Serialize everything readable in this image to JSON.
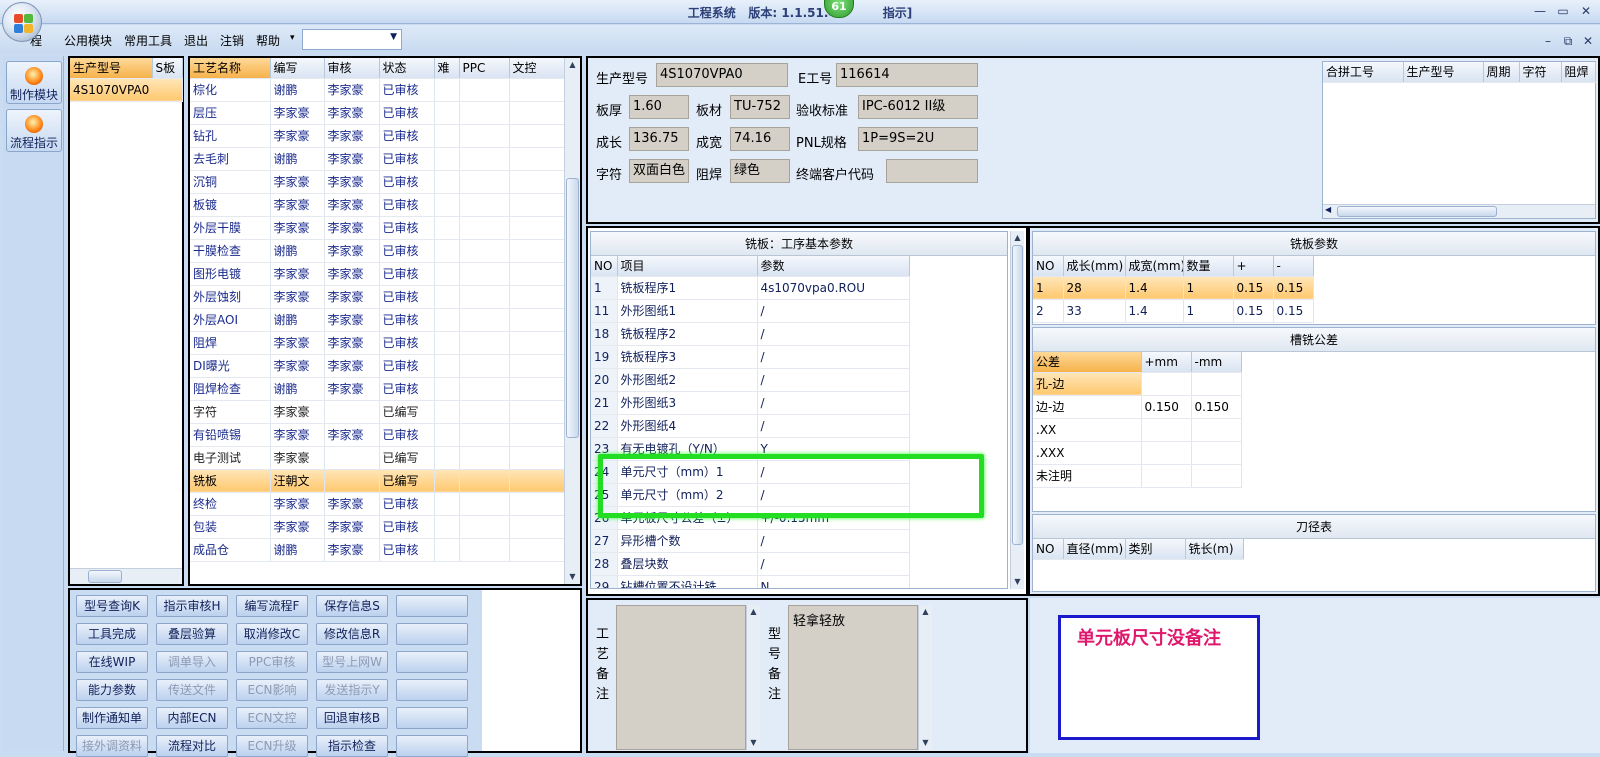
{
  "window": {
    "title_prefix": "工程系统",
    "version_label": "版本:",
    "version": "1.1.51.4",
    "title_suffix": "指示]",
    "badge": "61",
    "minimize": "—",
    "maximize": "▭",
    "close": "✕",
    "mdi_minimize": "–",
    "mdi_restore": "⧉",
    "mdi_close": "✕"
  },
  "menu": {
    "items": [
      "程",
      "公用模块",
      "常用工具",
      "退出",
      "注销",
      "帮助",
      "▾"
    ],
    "combo_value": ""
  },
  "left_toolbar": {
    "buttons": [
      "制作模块",
      "流程指示"
    ]
  },
  "model_list": {
    "headers": [
      "生产型号",
      "S板"
    ],
    "rows": [
      "4S1070VPA0"
    ]
  },
  "process_table": {
    "headers": [
      "工艺名称",
      "编写",
      "审核",
      "状态",
      "难",
      "PPC",
      "文控"
    ],
    "rows": [
      [
        "棕化",
        "谢鹏",
        "李家豪",
        "已审核"
      ],
      [
        "层压",
        "李家豪",
        "李家豪",
        "已审核"
      ],
      [
        "钻孔",
        "李家豪",
        "李家豪",
        "已审核"
      ],
      [
        "去毛刺",
        "谢鹏",
        "李家豪",
        "已审核"
      ],
      [
        "沉铜",
        "李家豪",
        "李家豪",
        "已审核"
      ],
      [
        "板镀",
        "李家豪",
        "李家豪",
        "已审核"
      ],
      [
        "外层干膜",
        "李家豪",
        "李家豪",
        "已审核"
      ],
      [
        "干膜检查",
        "谢鹏",
        "李家豪",
        "已审核"
      ],
      [
        "图形电镀",
        "李家豪",
        "李家豪",
        "已审核"
      ],
      [
        "外层蚀刻",
        "李家豪",
        "李家豪",
        "已审核"
      ],
      [
        "外层AOI",
        "谢鹏",
        "李家豪",
        "已审核"
      ],
      [
        "阻焊",
        "李家豪",
        "李家豪",
        "已审核"
      ],
      [
        "DI曝光",
        "李家豪",
        "李家豪",
        "已审核"
      ],
      [
        "阻焊检查",
        "谢鹏",
        "李家豪",
        "已审核"
      ],
      [
        "字符",
        "李家豪",
        "",
        "已编写"
      ],
      [
        "有铅喷锡",
        "李家豪",
        "李家豪",
        "已审核"
      ],
      [
        "电子测试",
        "李家豪",
        "",
        "已编写"
      ],
      [
        "铣板",
        "汪朝文",
        "",
        "已编写"
      ],
      [
        "终检",
        "李家豪",
        "李家豪",
        "已审核"
      ],
      [
        "包装",
        "李家豪",
        "李家豪",
        "已审核"
      ],
      [
        "成品仓",
        "谢鹏",
        "李家豪",
        "已审核"
      ]
    ]
  },
  "buttons": [
    [
      "型号查询K",
      "指示审核H",
      "编写流程F",
      "保存信息S",
      ""
    ],
    [
      "工具完成",
      "叠层验算",
      "取消修改C",
      "修改信息R",
      ""
    ],
    [
      "在线WIP",
      "调单导入",
      "PPC审核",
      "型号上网W",
      ""
    ],
    [
      "能力参数",
      "传送文件",
      "ECN影响",
      "发送指示Y",
      ""
    ],
    [
      "制作通知单",
      "内部ECN",
      "ECN文控",
      "回退审核B",
      ""
    ],
    [
      "接外调资料",
      "流程对比",
      "ECN升级",
      "指示检查",
      ""
    ]
  ],
  "info": {
    "model_label": "生产型号",
    "model": "4S1070VPA0",
    "e_label": "E工号",
    "e_no": "116614",
    "thick_label": "板厚",
    "thick": "1.60",
    "mat_label": "板材",
    "mat": "TU-752",
    "std_label": "验收标准",
    "std": "IPC-6012 II级",
    "len_label": "成长",
    "len": "136.75",
    "wid_label": "成宽",
    "wid": "74.16",
    "pnl_label": "PNL规格",
    "pnl": "1P=9S=2U",
    "char_label": "字符",
    "char": "双面白色",
    "mask_label": "阻焊",
    "mask": "绿色",
    "cust_label": "终端客户代码",
    "cust": ""
  },
  "merge_table": {
    "headers": [
      "合拼工号",
      "生产型号",
      "周期",
      "字符",
      "阻焊"
    ]
  },
  "mill_basic": {
    "title": "铣板：工序基本参数",
    "headers": [
      "NO",
      "项目",
      "参数"
    ],
    "rows": [
      [
        "1",
        "铣板程序1",
        "4s1070vpa0.ROU"
      ],
      [
        "11",
        "外形图纸1",
        "/"
      ],
      [
        "18",
        "铣板程序2",
        "/"
      ],
      [
        "19",
        "铣板程序3",
        "/"
      ],
      [
        "20",
        "外形图纸2",
        "/"
      ],
      [
        "21",
        "外形图纸3",
        "/"
      ],
      [
        "22",
        "外形图纸4",
        "/"
      ],
      [
        "23",
        "有无电镀孔（Y/N）",
        "Y"
      ],
      [
        "24",
        "单元尺寸（mm）1",
        "/"
      ],
      [
        "25",
        "单元尺寸（mm）2",
        "/"
      ],
      [
        "26",
        "单元板尺寸公差（±）",
        "+/-0.15mm"
      ],
      [
        "27",
        "异形槽个数",
        "/"
      ],
      [
        "28",
        "叠层块数",
        "/"
      ],
      [
        "29",
        "钻槽位置不设计铣...",
        "N"
      ]
    ]
  },
  "mill_params": {
    "title": "铣板参数",
    "headers": [
      "NO",
      "成长(mm)",
      "成宽(mm)",
      "数量",
      "+",
      "-"
    ],
    "rows": [
      [
        "1",
        "28",
        "1.4",
        "1",
        "0.15",
        "0.15"
      ],
      [
        "2",
        "33",
        "1.4",
        "1",
        "0.15",
        "0.15"
      ]
    ]
  },
  "slot_tol": {
    "title": "槽铣公差",
    "headers": [
      "公差",
      "+mm",
      "-mm"
    ],
    "rows": [
      [
        "孔-边",
        "",
        ""
      ],
      [
        "边-边",
        "0.150",
        "0.150"
      ],
      [
        ".XX",
        "",
        ""
      ],
      [
        ".XXX",
        "",
        ""
      ],
      [
        "未注明",
        "",
        ""
      ]
    ]
  },
  "knife": {
    "title": "刀径表",
    "headers": [
      "NO",
      "直径(mm)",
      "类别",
      "铣长(m)"
    ]
  },
  "notes": {
    "proc_label": "工艺备注",
    "proc_text": "",
    "model_label": "型号备注",
    "model_text": "轻拿轻放"
  },
  "callout": {
    "text": "单元板尺寸没备注",
    "color": "#e0186c",
    "border": "#1a1acc"
  },
  "highlight_color": "#22dd22"
}
